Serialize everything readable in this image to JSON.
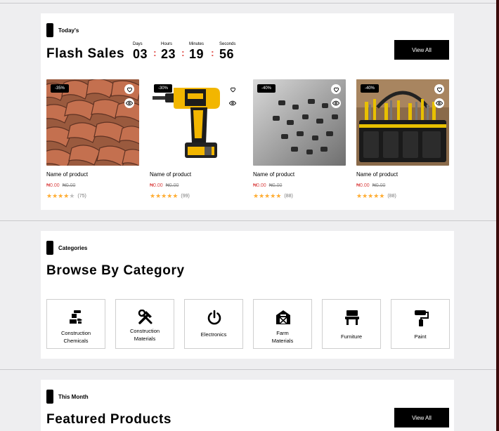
{
  "flash": {
    "label": "Today's",
    "title": "Flash Sales",
    "view_all": "View All",
    "countdown": [
      {
        "label": "Days",
        "value": "03"
      },
      {
        "label": "Hours",
        "value": "23"
      },
      {
        "label": "Minutes",
        "value": "19"
      },
      {
        "label": "Seconds",
        "value": "56"
      }
    ],
    "separator": ":",
    "products": [
      {
        "name": "Name of product",
        "discount": "-35%",
        "price": "₦0.00",
        "old_price": "₦0.00",
        "stars": 4,
        "reviews": "(75)"
      },
      {
        "name": "Name of product",
        "discount": "-30%",
        "price": "₦0.00",
        "old_price": "₦0.00",
        "stars": 5,
        "reviews": "(99)"
      },
      {
        "name": "Name of product",
        "discount": "-40%",
        "price": "₦0.00",
        "old_price": "₦0.00",
        "stars": 5,
        "reviews": "(88)"
      },
      {
        "name": "Name of product",
        "discount": "-40%",
        "price": "₦0.00",
        "old_price": "₦0.00",
        "stars": 5,
        "reviews": "(88)"
      }
    ]
  },
  "categories": {
    "label": "Categories",
    "title": "Browse By Category",
    "items": [
      {
        "line1": "Construction",
        "line2": "Chemicals",
        "icon": "chemicals-icon"
      },
      {
        "line1": "Construction",
        "line2": "Materials",
        "icon": "tools-icon"
      },
      {
        "line1": "Electronics",
        "line2": "",
        "icon": "power-icon"
      },
      {
        "line1": "Farm",
        "line2": "Materials",
        "icon": "barn-icon"
      },
      {
        "line1": "Furniture",
        "line2": "",
        "icon": "chair-icon"
      },
      {
        "line1": "Paint",
        "line2": "",
        "icon": "paint-roller-icon"
      }
    ]
  },
  "featured": {
    "label": "This Month",
    "title": "Featured Products",
    "view_all": "View All"
  },
  "colors": {
    "accent": "#db4444",
    "star": "#ffad33",
    "button": "#000000"
  }
}
